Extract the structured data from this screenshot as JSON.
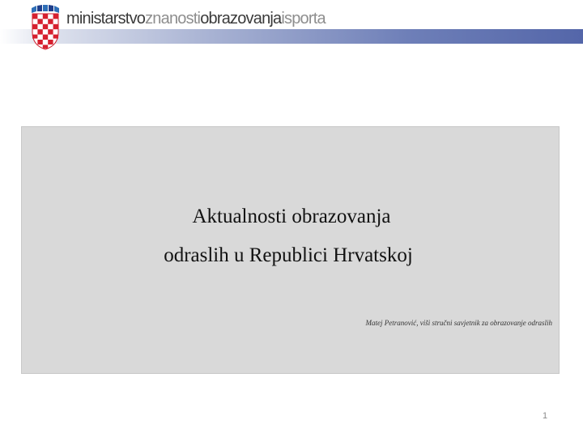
{
  "header": {
    "brand_part1": "ministarstvo",
    "brand_part2": "znanosti",
    "brand_part3": "obrazovanja",
    "brand_part4": "isporta",
    "brand_dark": "#3a3a3a",
    "brand_light": "#8e8e8e",
    "band_color": "#5466a9",
    "coat_icon": "croatian-coat-of-arms-icon"
  },
  "slide": {
    "title_line1": "Aktualnosti obrazovanja",
    "title_line2": "odraslih u Republici Hrvatskoj",
    "author": "Matej Petranović, viši stručni savjetnik za obrazovanje odraslih",
    "page_number": "1",
    "box_color": "#d9d9d9"
  }
}
